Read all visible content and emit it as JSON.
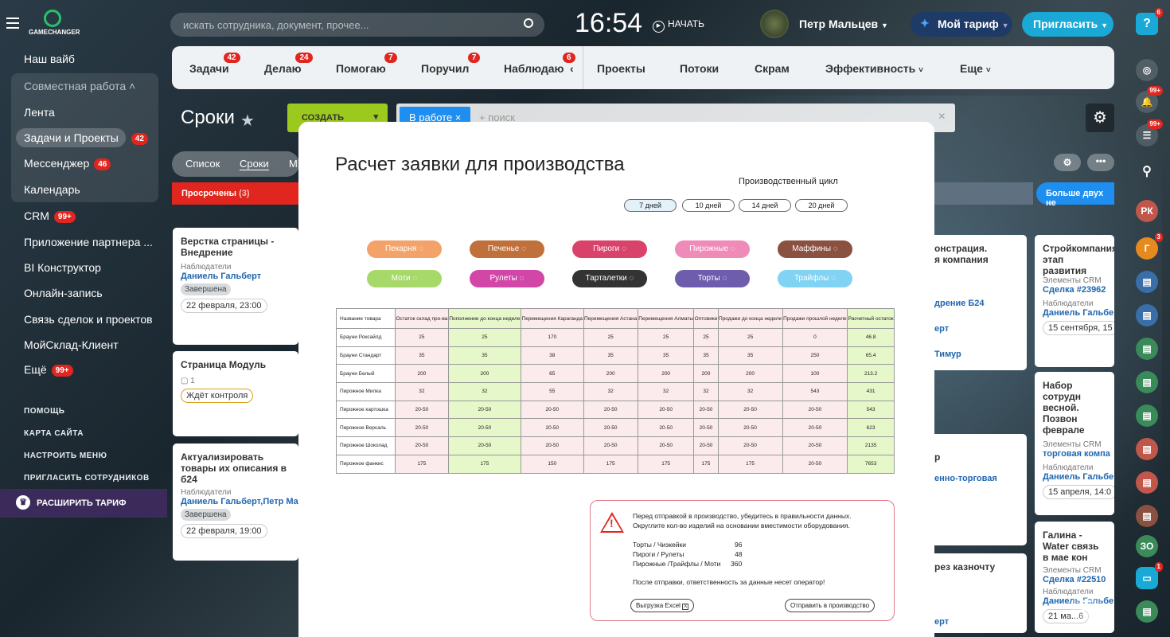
{
  "app": {
    "logo": "GAMECHANGER",
    "search_placeholder": "искать сотрудника, документ, прочее...",
    "time": "16:54",
    "start": "НАЧАТЬ",
    "user": "Петр Мальцев",
    "tariff": "Мой тариф",
    "invite": "Пригласить",
    "help_badge": "6"
  },
  "sidebar": {
    "items": [
      {
        "label": "Наш вайб"
      },
      {
        "label": "Совместная работа"
      },
      {
        "label": "Лента"
      },
      {
        "label": "Задачи и Проекты",
        "count": "42"
      },
      {
        "label": "Мессенджер",
        "count": "46"
      },
      {
        "label": "Календарь"
      },
      {
        "label": "CRM",
        "count": "99+"
      },
      {
        "label": "Приложение партнера ..."
      },
      {
        "label": "BI Конструктор"
      },
      {
        "label": "Онлайн-запись"
      },
      {
        "label": "Связь сделок и проектов"
      },
      {
        "label": "МойСклад-Клиент"
      },
      {
        "label": "Ещё",
        "count": "99+"
      }
    ],
    "links": [
      "ПОМОЩЬ",
      "КАРТА САЙТА",
      "НАСТРОИТЬ МЕНЮ",
      "ПРИГЛАСИТЬ СОТРУДНИКОВ"
    ],
    "expand": "РАСШИРИТЬ ТАРИФ"
  },
  "tabs": [
    {
      "label": "Задачи",
      "count": "42"
    },
    {
      "label": "Делаю",
      "count": "24"
    },
    {
      "label": "Помогаю",
      "count": "7"
    },
    {
      "label": "Поручил",
      "count": "7"
    },
    {
      "label": "Наблюдаю",
      "count": "6"
    },
    {
      "label": "Проекты"
    },
    {
      "label": "Потоки"
    },
    {
      "label": "Скрам"
    },
    {
      "label": "Эффективность"
    },
    {
      "label": "Еще"
    }
  ],
  "page": {
    "title": "Сроки",
    "create": "СОЗДАТЬ",
    "filter_chip": "В работе",
    "filter_placeholder": "+ поиск",
    "views": [
      "Список",
      "Сроки",
      "М"
    ],
    "overdue": "Просрочены",
    "overdue_count": "(3)",
    "more_weeks": "Больше двух не"
  },
  "cards": [
    {
      "title": "Верстка страницы - Внедрение",
      "label": "Наблюдатели",
      "person": "Даниель Гальберт",
      "status": "Завершена",
      "date": "22 февраля, 23:00"
    },
    {
      "title": "Страница Модуль",
      "counter": "1",
      "status": "Ждёт контроля"
    },
    {
      "title": "Актуализировать товары их описания в б24",
      "label": "Наблюдатели",
      "person": "Даниель Гальберт,Петр Ма",
      "status": "Завершена",
      "date": "22 февраля, 19:00"
    }
  ],
  "right_cards": [
    {
      "title": "Стройкомпания этап развития",
      "label1": "Элементы CRM",
      "link": "Сделка #23962",
      "label2": "Наблюдатели",
      "person": "Даниель Гальбе",
      "date": "15 сентября, 15"
    },
    {
      "title": "Набор сотрудн весной. Позвон феврале",
      "label1": "Элементы CRM",
      "link": "торговая компа",
      "label2": "Наблюдатели",
      "person": "Даниель Гальбе",
      "date": "15 апреля, 14:0"
    },
    {
      "title": "Галина - Water связь в мае кон",
      "label1": "Элементы CRM",
      "link": "Сделка #22510",
      "label2": "Наблюдатели",
      "person": "Даниель Гальбе",
      "date": "21 ма...6"
    }
  ],
  "mid_cards": [
    "онстрация.",
    "я компания",
    "дрение Б24",
    "ерт",
    "Тимур",
    "р",
    "енно-торговая",
    "рез казночту",
    "ерт"
  ],
  "modal": {
    "title": "Расчет заявки для производства",
    "cycle_label": "Производственный цикл",
    "cycles": [
      "7 дней",
      "10 дней",
      "14 дней",
      "20 дней"
    ],
    "categories": [
      {
        "name": "Пекарня",
        "color": "#f3a36a"
      },
      {
        "name": "Печенье",
        "color": "#c0703a"
      },
      {
        "name": "Пироги",
        "color": "#d9436b"
      },
      {
        "name": "Пирожные",
        "color": "#f08ab8"
      },
      {
        "name": "Маффины",
        "color": "#8a5040"
      },
      {
        "name": "Моти",
        "color": "#a6d86a"
      },
      {
        "name": "Рулеты",
        "color": "#d246a8"
      },
      {
        "name": "Тарталетки",
        "color": "#333333"
      },
      {
        "name": "Торты",
        "color": "#6e5cad"
      },
      {
        "name": "Трайфлы",
        "color": "#80d3f2"
      }
    ],
    "columns": [
      "Название товара",
      "Остаток склад про-ва",
      "Пополнение до конца неделе",
      "Перемещения Караганда",
      "Перемещения Астана",
      "Перемещения Алматы",
      "Оптовики",
      "Продажи до конца неделе",
      "Продажи прошлой неделе",
      "Расчетный остаток"
    ],
    "rows": [
      [
        "Брауни Роксайлд",
        "25",
        "25",
        "170",
        "25",
        "25",
        "25",
        "25",
        "0",
        "46.8"
      ],
      [
        "Брауни Стандарт",
        "35",
        "35",
        "38",
        "35",
        "35",
        "35",
        "35",
        "250",
        "65.4"
      ],
      [
        "Брауни Белый",
        "200",
        "200",
        "65",
        "200",
        "200",
        "200",
        "200",
        "100",
        "213.2"
      ],
      [
        "Пирожное Милка",
        "32",
        "32",
        "55",
        "32",
        "32",
        "32",
        "32",
        "543",
        "431"
      ],
      [
        "Пирожное картошка",
        "20-50",
        "20-50",
        "20-50",
        "20-50",
        "20-50",
        "20-50",
        "20-50",
        "20-50",
        "543"
      ],
      [
        "Пирожное Версаль",
        "20-50",
        "20-50",
        "20-50",
        "20-50",
        "20-50",
        "20-50",
        "20-50",
        "20-50",
        "623"
      ],
      [
        "Пирожное Шоколад",
        "20-50",
        "20-50",
        "20-50",
        "20-50",
        "20-50",
        "20-50",
        "20-50",
        "20-50",
        "2135"
      ],
      [
        "Пирожное фанкис",
        "175",
        "175",
        "150",
        "175",
        "175",
        "175",
        "175",
        "20-50",
        "7653"
      ]
    ],
    "warning": {
      "line1": "Перед отправкой в производство, убедитесь в правильности данных.",
      "line2": "Округлите кол-во изделий на основании вместимости оборудования.",
      "items": [
        {
          "name": "Торты / Чизкейки",
          "value": "96"
        },
        {
          "name": "Пироги / Рулеты",
          "value": "48"
        },
        {
          "name": "Пирожные /Трайфлы / Моти",
          "value": "360"
        }
      ],
      "note": "После отправки, ответственность за данные несет оператор!",
      "export": "Выгрузка Excel",
      "send": "Отправить в производство"
    }
  },
  "right_rail": {
    "badges": [
      "99+",
      "99+",
      "3",
      "1"
    ],
    "initials": [
      "РК",
      "Г",
      "ЗО"
    ]
  }
}
